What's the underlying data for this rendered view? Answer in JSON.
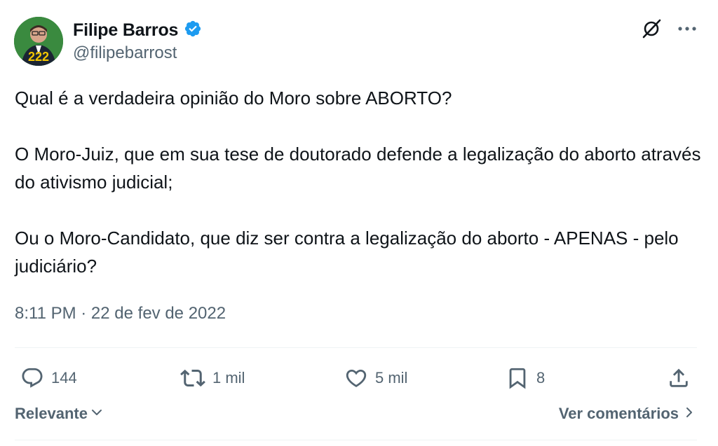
{
  "author": {
    "display_name": "Filipe Barros",
    "handle": "@filipebarrost",
    "verified_icon": "verified-badge-icon",
    "avatar_badge": "222"
  },
  "tweet": {
    "text": "Qual é a verdadeira opinião do Moro sobre ABORTO?\n\nO Moro-Juiz, que em sua tese de doutorado defende a legalização do aborto através do ativismo judicial;\n\nOu o Moro-Candidato, que diz ser contra a legalização do aborto - APENAS - pelo judiciário?",
    "timestamp": "8:11 PM · 22 de fev de 2022"
  },
  "metrics": {
    "replies": "144",
    "retweets": "1 mil",
    "likes": "5 mil",
    "bookmarks": "8"
  },
  "footer": {
    "sort_label": "Relevante",
    "view_comments_label": "Ver comentários"
  },
  "colors": {
    "text": "#0f1419",
    "secondary": "#536471",
    "verified": "#1d9bf0",
    "divider": "#eff3f4"
  }
}
